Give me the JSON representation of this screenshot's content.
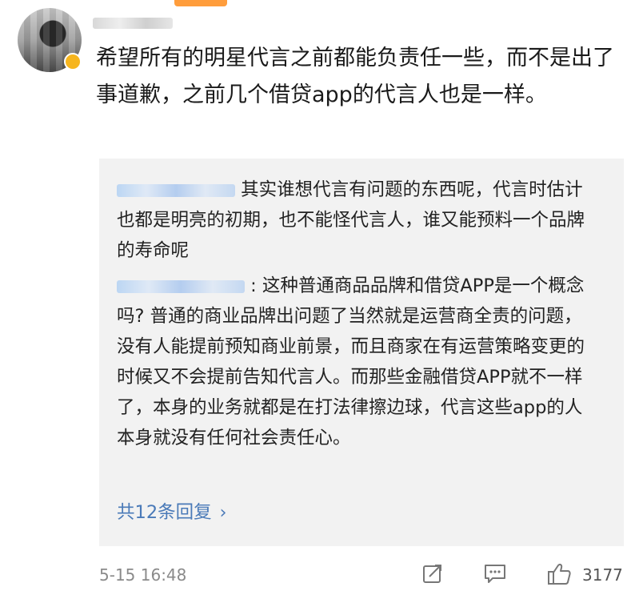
{
  "comment": {
    "text": "希望所有的明星代言之前都能负责任一些，而不是出了事道歉，之前几个借贷app的代言人也是一样。",
    "time": "5-15 16:48",
    "like_count": "3177"
  },
  "replies": [
    {
      "text": "其实谁想代言有问题的东西呢，代言时估计也都是明亮的初期，也不能怪代言人，谁又能预料一个品牌的寿命呢"
    },
    {
      "text": ": 这种普通商品品牌和借贷APP是一个概念吗? 普通的商业品牌出问题了当然就是运营商全责的问题，没有人能提前预知商业前景，而且商家在有运营策略变更的时候又不会提前告知代言人。而那些金融借贷APP就不一样了，本身的业务就都是在打法律擦边球，代言这些app的人本身就没有任何社会责任心。"
    }
  ],
  "more_replies_label": "共12条回复",
  "icons": {
    "share": "share-icon",
    "comment": "comment-icon",
    "like": "thumbs-up-icon",
    "more": "chevron-right-icon"
  }
}
